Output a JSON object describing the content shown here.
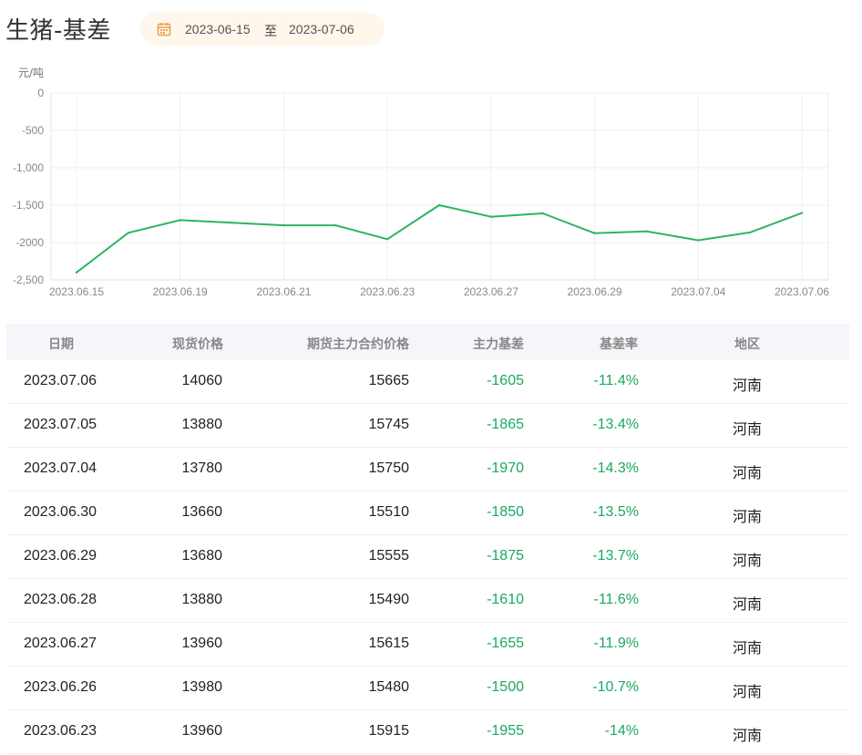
{
  "header": {
    "title": "生猪-基差",
    "date_start": "2023-06-15",
    "date_sep": "至",
    "date_end": "2023-07-06",
    "calendar_icon": "calendar-icon",
    "accent_color": "#e8a04a"
  },
  "chart_data": {
    "type": "line",
    "ylabel": "元/吨",
    "ylim": [
      -2500,
      0
    ],
    "yticks": [
      0,
      -500,
      -1000,
      -1500,
      -2000,
      -2500
    ],
    "ytick_labels": [
      "0",
      "-500",
      "-1,000",
      "-1,500",
      "-2000",
      "-2,500"
    ],
    "x_tick_labels": [
      "2023.06.15",
      "2023.06.19",
      "2023.06.21",
      "2023.06.23",
      "2023.06.27",
      "2023.06.29",
      "2023.07.04",
      "2023.07.06"
    ],
    "grid": true,
    "line_color": "#2db463",
    "x": [
      "2023.06.15",
      "2023.06.16",
      "2023.06.19",
      "2023.06.20",
      "2023.06.21",
      "2023.06.22",
      "2023.06.23",
      "2023.06.26",
      "2023.06.27",
      "2023.06.28",
      "2023.06.29",
      "2023.06.30",
      "2023.07.04",
      "2023.07.05",
      "2023.07.06"
    ],
    "values": [
      -2400,
      -1870,
      -1700,
      -1735,
      -1770,
      -1770,
      -1955,
      -1500,
      -1655,
      -1610,
      -1875,
      -1850,
      -1970,
      -1865,
      -1605
    ]
  },
  "table": {
    "headers": [
      "日期",
      "现货价格",
      "期货主力合约价格",
      "主力基差",
      "基差率",
      "地区"
    ],
    "rows": [
      {
        "date": "2023.07.06",
        "spot": "14060",
        "futures": "15665",
        "basis": "-1605",
        "rate": "-11.4%",
        "region": "河南"
      },
      {
        "date": "2023.07.05",
        "spot": "13880",
        "futures": "15745",
        "basis": "-1865",
        "rate": "-13.4%",
        "region": "河南"
      },
      {
        "date": "2023.07.04",
        "spot": "13780",
        "futures": "15750",
        "basis": "-1970",
        "rate": "-14.3%",
        "region": "河南"
      },
      {
        "date": "2023.06.30",
        "spot": "13660",
        "futures": "15510",
        "basis": "-1850",
        "rate": "-13.5%",
        "region": "河南"
      },
      {
        "date": "2023.06.29",
        "spot": "13680",
        "futures": "15555",
        "basis": "-1875",
        "rate": "-13.7%",
        "region": "河南"
      },
      {
        "date": "2023.06.28",
        "spot": "13880",
        "futures": "15490",
        "basis": "-1610",
        "rate": "-11.6%",
        "region": "河南"
      },
      {
        "date": "2023.06.27",
        "spot": "13960",
        "futures": "15615",
        "basis": "-1655",
        "rate": "-11.9%",
        "region": "河南"
      },
      {
        "date": "2023.06.26",
        "spot": "13980",
        "futures": "15480",
        "basis": "-1500",
        "rate": "-10.7%",
        "region": "河南"
      },
      {
        "date": "2023.06.23",
        "spot": "13960",
        "futures": "15915",
        "basis": "-1955",
        "rate": "-14%",
        "region": "河南"
      }
    ]
  }
}
